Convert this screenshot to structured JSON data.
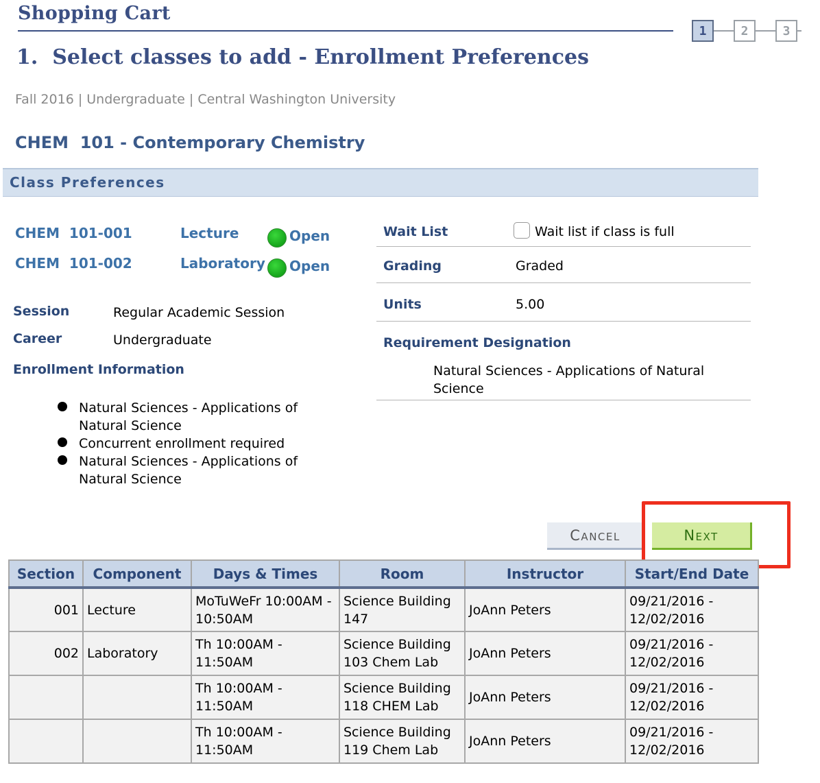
{
  "header": {
    "title": "Shopping Cart",
    "step_title": "1.  Select classes to add - Enrollment Preferences",
    "steps": [
      "1",
      "2",
      "3"
    ],
    "active_step": 1
  },
  "term_line": "Fall 2016 | Undergraduate | Central Washington University",
  "course_title": "CHEM  101 - Contemporary Chemistry",
  "class_preferences_label": "Class Preferences",
  "class_sections": [
    {
      "section": "CHEM  101-001",
      "component": "Lecture",
      "status": "Open"
    },
    {
      "section": "CHEM  101-002",
      "component": "Laboratory",
      "status": "Open"
    }
  ],
  "session": {
    "label": "Session",
    "value": "Regular Academic Session"
  },
  "career": {
    "label": "Career",
    "value": "Undergraduate"
  },
  "enrollment_info": {
    "label": "Enrollment Information",
    "items": [
      "Natural Sciences - Applications of Natural Science",
      "Concurrent enrollment required",
      "Natural Sciences - Applications of Natural Science"
    ]
  },
  "wait_list": {
    "label": "Wait List",
    "checkbox_label": "Wait list if class is full",
    "checked": false
  },
  "grading": {
    "label": "Grading",
    "value": "Graded"
  },
  "units": {
    "label": "Units",
    "value": "5.00"
  },
  "requirement": {
    "label": "Requirement Designation",
    "value": "Natural Sciences - Applications of Natural Science"
  },
  "buttons": {
    "cancel": "Cancel",
    "next": "Next"
  },
  "colors": {
    "accent": "#3b4f83",
    "highlight": "#ee2e1d",
    "next_bg": "#d5eca1",
    "status_open": "#17a51c"
  },
  "table": {
    "headers": [
      "Section",
      "Component",
      "Days & Times",
      "Room",
      "Instructor",
      "Start/End Date"
    ],
    "rows": [
      [
        "001",
        "Lecture",
        "MoTuWeFr 10:00AM - 10:50AM",
        "Science Building 147",
        "JoAnn Peters",
        "09/21/2016 - 12/02/2016"
      ],
      [
        "002",
        "Laboratory",
        "Th 10:00AM - 11:50AM",
        "Science Building 103 Chem Lab",
        "JoAnn Peters",
        "09/21/2016 - 12/02/2016"
      ],
      [
        "",
        "",
        "Th 10:00AM - 11:50AM",
        "Science Building 118 CHEM Lab",
        "JoAnn Peters",
        "09/21/2016 - 12/02/2016"
      ],
      [
        "",
        "",
        "Th 10:00AM - 11:50AM",
        "Science Building 119 Chem Lab",
        "JoAnn Peters",
        "09/21/2016 - 12/02/2016"
      ]
    ]
  }
}
